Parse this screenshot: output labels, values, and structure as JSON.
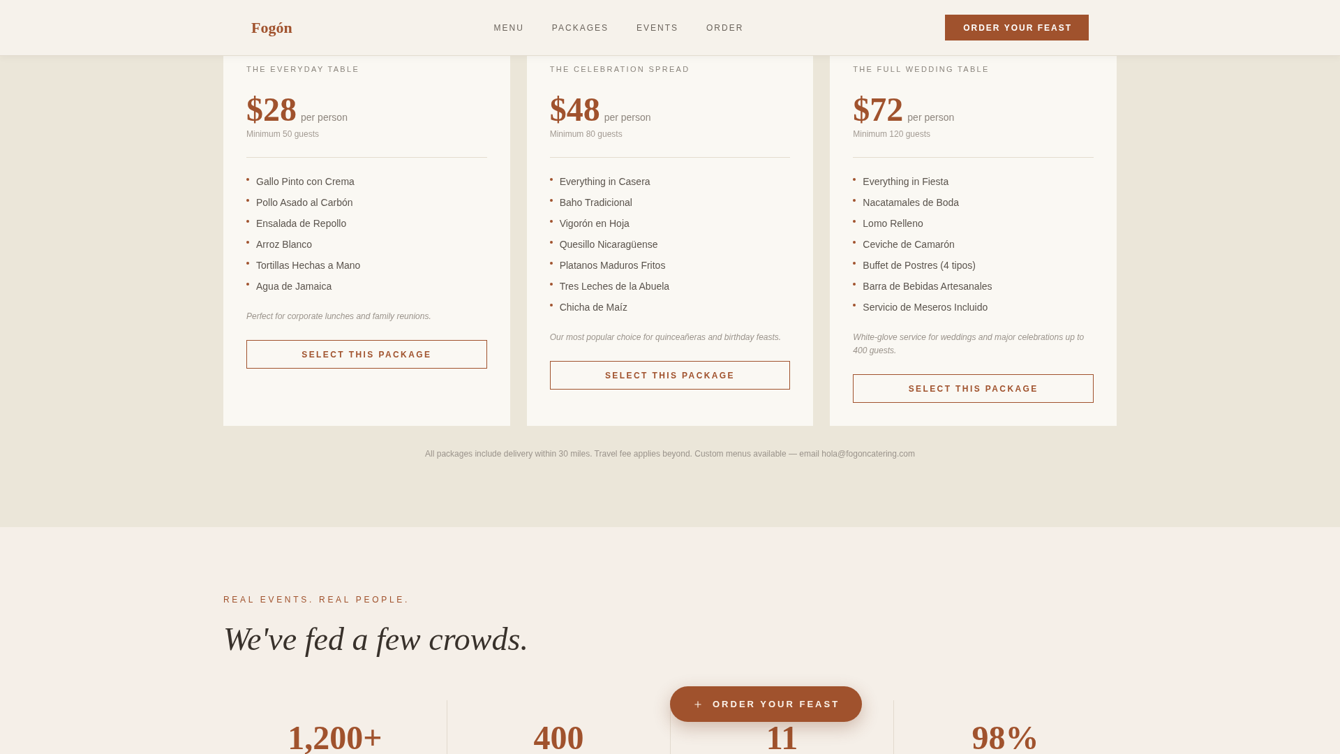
{
  "header": {
    "logo": "Fogón",
    "nav": [
      "MENU",
      "PACKAGES",
      "EVENTS",
      "ORDER"
    ],
    "cta": "ORDER YOUR FEAST"
  },
  "packages": [
    {
      "subtitle": "THE EVERYDAY TABLE",
      "price": "$28",
      "unit": "per person",
      "minimum": "Minimum 50 guests",
      "items": [
        "Gallo Pinto con Crema",
        "Pollo Asado al Carbón",
        "Ensalada de Repollo",
        "Arroz Blanco",
        "Tortillas Hechas a Mano",
        "Agua de Jamaica"
      ],
      "note": "Perfect for corporate lunches and family reunions.",
      "button": "SELECT THIS PACKAGE"
    },
    {
      "subtitle": "THE CELEBRATION SPREAD",
      "price": "$48",
      "unit": "per person",
      "minimum": "Minimum 80 guests",
      "items": [
        "Everything in Casera",
        "Baho Tradicional",
        "Vigorón en Hoja",
        "Quesillo Nicaragüense",
        "Platanos Maduros Fritos",
        "Tres Leches de la Abuela",
        "Chicha de Maíz"
      ],
      "note": "Our most popular choice for quinceañeras and birthday feasts.",
      "button": "SELECT THIS PACKAGE"
    },
    {
      "subtitle": "THE FULL WEDDING TABLE",
      "price": "$72",
      "unit": "per person",
      "minimum": "Minimum 120 guests",
      "items": [
        "Everything in Fiesta",
        "Nacatamales de Boda",
        "Lomo Relleno",
        "Ceviche de Camarón",
        "Buffet de Postres (4 tipos)",
        "Barra de Bebidas Artesanales",
        "Servicio de Meseros Incluido"
      ],
      "note": "White-glove service for weddings and major celebrations up to 400 guests.",
      "button": "SELECT THIS PACKAGE"
    }
  ],
  "footnote": "All packages include delivery within 30 miles. Travel fee applies beyond. Custom menus available — email hola@fogoncatering.com",
  "events": {
    "eyebrow": "REAL EVENTS. REAL PEOPLE.",
    "heading": "We've fed a few crowds.",
    "stats": [
      "1,200+",
      "400",
      "11",
      "98%"
    ]
  },
  "floating_button": {
    "label": "ORDER YOUR FEAST"
  }
}
